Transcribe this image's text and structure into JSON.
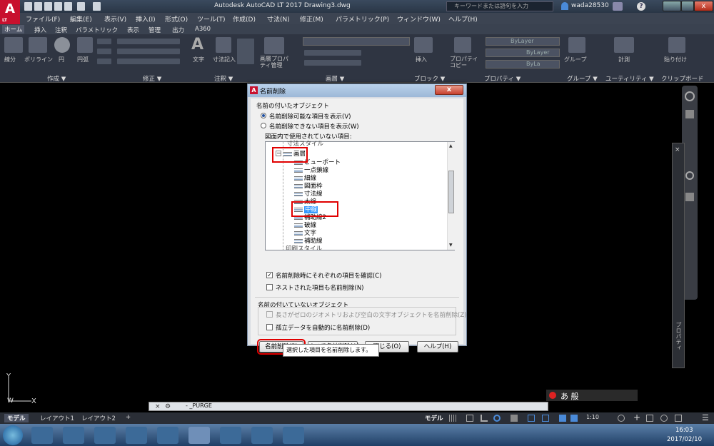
{
  "app": {
    "logo": "A",
    "logo_sub": "LT",
    "title": "Autodesk AutoCAD LT 2017    Drawing3.dwg",
    "search_placeholder": "キーワードまたは語句を入力",
    "user": "wada28530"
  },
  "menu": [
    "ファイル(F)",
    "編集(E)",
    "表示(V)",
    "挿入(I)",
    "形式(O)",
    "ツール(T)",
    "作成(D)",
    "寸法(N)",
    "修正(M)",
    "パラメトリック(P)",
    "ウィンドウ(W)",
    "ヘルプ(H)"
  ],
  "ribbon_tabs": [
    "ホーム",
    "挿入",
    "注釈",
    "パラメトリック",
    "表示",
    "管理",
    "出力",
    "A360"
  ],
  "ribbon_panels": [
    "作成 ▼",
    "修正 ▼",
    "注釈 ▼",
    "画層 ▼",
    "ブロック ▼",
    "プロパティ ▼",
    "グループ ▼",
    "ユーティリティ ▼",
    "クリップボード"
  ],
  "ribbon_tools": {
    "line": "線分",
    "polyline": "ポリライン",
    "circle": "円",
    "arc": "円弧",
    "text": "文字",
    "dimension": "寸法記入",
    "layer_props": "画層プロパティ管理",
    "insert": "挿入",
    "match_props": "プロパティコピー",
    "bylayer1": "ByLayer",
    "bylayer2": "ByLayer",
    "bylayer3": "ByLa",
    "group": "グループ",
    "measure": "計測",
    "paste": "貼り付け"
  },
  "dialog": {
    "title": "名前削除",
    "close": "x",
    "section_named": "名前の付いたオブジェクト",
    "radio_purgeable": "名前削除可能な項目を表示(V)",
    "radio_nonpurgeable": "名前削除できない項目を表示(W)",
    "tree_caption": "図面内で使用されていない項目:",
    "tree": {
      "top_partial": "寸法スタイル",
      "layers": "画層",
      "items": [
        "ビューポート",
        "一点鎖線",
        "細線",
        "図面枠",
        "寸法線",
        "太線",
        "中線",
        "補助線2",
        "破線",
        "文字",
        "補助線"
      ],
      "bottom_partial": "印刷スタイル"
    },
    "chk_confirm": "名前削除時にそれぞれの項目を確認(C)",
    "chk_nested": "ネストされた項目も名前削除(N)",
    "section_unnamed": "名前の付いていないオブジェクト",
    "chk_zero_length": "長さがゼロのジオメトリおよび空白の文字オブジェクトを名前削除(Z)",
    "chk_orphan": "孤立データを自動的に名前削除(D)",
    "btn_purge": "名前削除(P)",
    "btn_purge_all": "すべて名前削除(A)",
    "btn_close": "閉じる(O)",
    "btn_help": "ヘルプ(H)",
    "tooltip": "選択した項目を名前削除します。"
  },
  "command_line": {
    "text": "- _PURGE"
  },
  "ime": {
    "text": "あ 般"
  },
  "layout_tabs": [
    "モデル",
    "レイアウト1",
    "レイアウト2",
    "+"
  ],
  "status": {
    "model": "モデル",
    "scale": "1:10"
  },
  "side_palette": "プロパティ",
  "ucs": {
    "y": "Y",
    "x": "X",
    "w": "W"
  },
  "clock": {
    "time": "16:03",
    "date": "2017/02/10"
  },
  "colors": {
    "highlight": "#e00000",
    "selection": "#3399ff"
  }
}
